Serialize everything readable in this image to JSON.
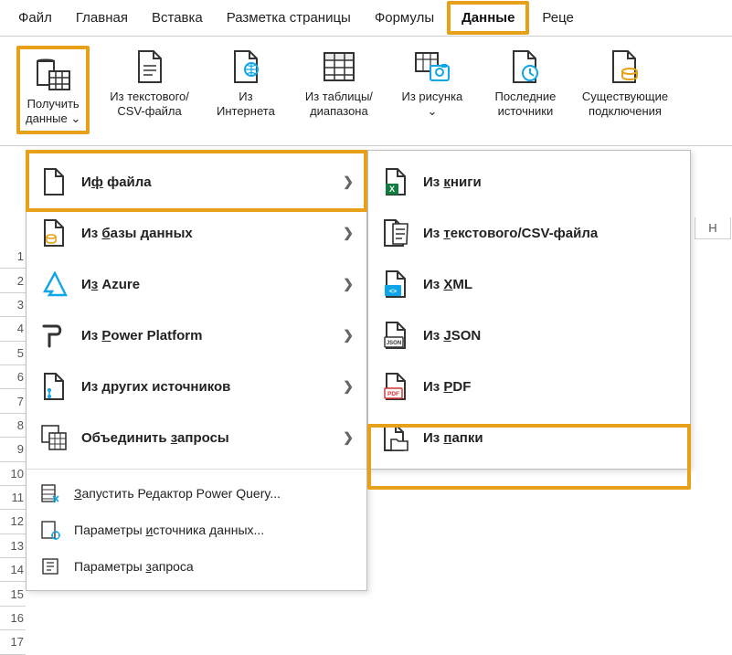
{
  "tabs": {
    "file": "Файл",
    "home": "Главная",
    "insert": "Вставка",
    "pagelayout": "Разметка страницы",
    "formulas": "Формулы",
    "data": "Данные",
    "review": "Реце"
  },
  "ribbon": {
    "get_data_l1": "Получить",
    "get_data_l2": "данные",
    "from_csv_l1": "Из текстового/",
    "from_csv_l2": "CSV-файла",
    "from_web_l1": "Из",
    "from_web_l2": "Интернета",
    "from_table_l1": "Из таблицы/",
    "from_table_l2": "диапазона",
    "from_picture_l1": "Из рисунка",
    "recent_l1": "Последние",
    "recent_l2": "источники",
    "existing_l1": "Существующие",
    "existing_l2": "подключения"
  },
  "menu_left": {
    "from_file": "Из файла",
    "from_file_u": "ф",
    "from_db": "Из базы данных",
    "from_db_u": "б",
    "from_azure": "Из Azure",
    "from_azure_u": "з",
    "from_pp": "Из Power Platform",
    "from_pp_u": "P",
    "from_other": "Из других источников",
    "from_other_u": "д",
    "combine": "Объединить запросы",
    "combine_u": "з",
    "launch_pq": "Запустить Редактор Power Query...",
    "launch_pq_u": "З",
    "ds_params": "Параметры источника данных...",
    "ds_params_u": "и",
    "q_params": "Параметры запроса",
    "q_params_u": "з"
  },
  "menu_right": {
    "from_workbook": "Из книги",
    "from_workbook_u": "к",
    "from_text": "Из текстового/CSV-файла",
    "from_text_u": "т",
    "from_xml": "Из XML",
    "from_xml_u": "X",
    "from_json": "Из JSON",
    "from_json_u": "J",
    "from_pdf": "Из PDF",
    "from_pdf_u": "P",
    "from_folder": "Из папки",
    "from_folder_u": "п"
  },
  "grid": {
    "col_h": "H",
    "rows": [
      "1",
      "2",
      "3",
      "4",
      "5",
      "6",
      "7",
      "8",
      "9",
      "10",
      "11",
      "12",
      "13",
      "14",
      "15",
      "16",
      "17"
    ]
  }
}
